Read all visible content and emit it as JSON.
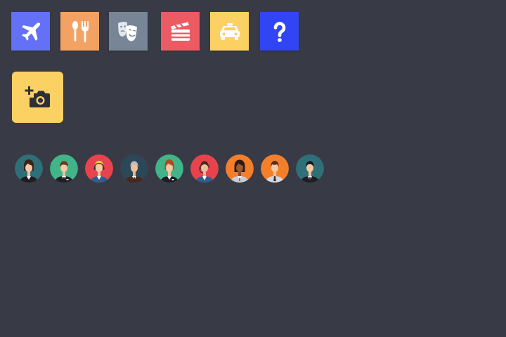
{
  "categories": [
    {
      "icon": "airplane-icon",
      "color": "#6470f5"
    },
    {
      "icon": "fork-spoon-icon",
      "color": "#f4a263"
    },
    {
      "icon": "theater-masks-icon",
      "color": "#788596"
    },
    {
      "icon": "clapperboard-icon",
      "color": "#ec5a64"
    },
    {
      "icon": "taxi-icon",
      "color": "#fcd163"
    },
    {
      "icon": "question-mark-icon",
      "color": "#3245f5"
    }
  ],
  "add_photo": {
    "icon": "add-photo-camera-icon",
    "color": "#fcd163"
  },
  "avatars": [
    {
      "icon": "woman-dark-hair-suit-avatar",
      "bg": "#2f6f78"
    },
    {
      "icon": "man-suit-badge-avatar",
      "bg": "#41b489"
    },
    {
      "icon": "woman-blonde-headset-avatar",
      "bg": "#e8434d"
    },
    {
      "icon": "man-gray-hair-suit-avatar",
      "bg": "#2c4758"
    },
    {
      "icon": "woman-red-hair-badge-avatar",
      "bg": "#41b489"
    },
    {
      "icon": "man-headset-avatar",
      "bg": "#e8434d"
    },
    {
      "icon": "woman-dark-skin-avatar",
      "bg": "#f47f2a"
    },
    {
      "icon": "man-brown-hair-tie-avatar",
      "bg": "#f47f2a"
    },
    {
      "icon": "man-black-hair-suit-avatar",
      "bg": "#2f6f78"
    }
  ]
}
